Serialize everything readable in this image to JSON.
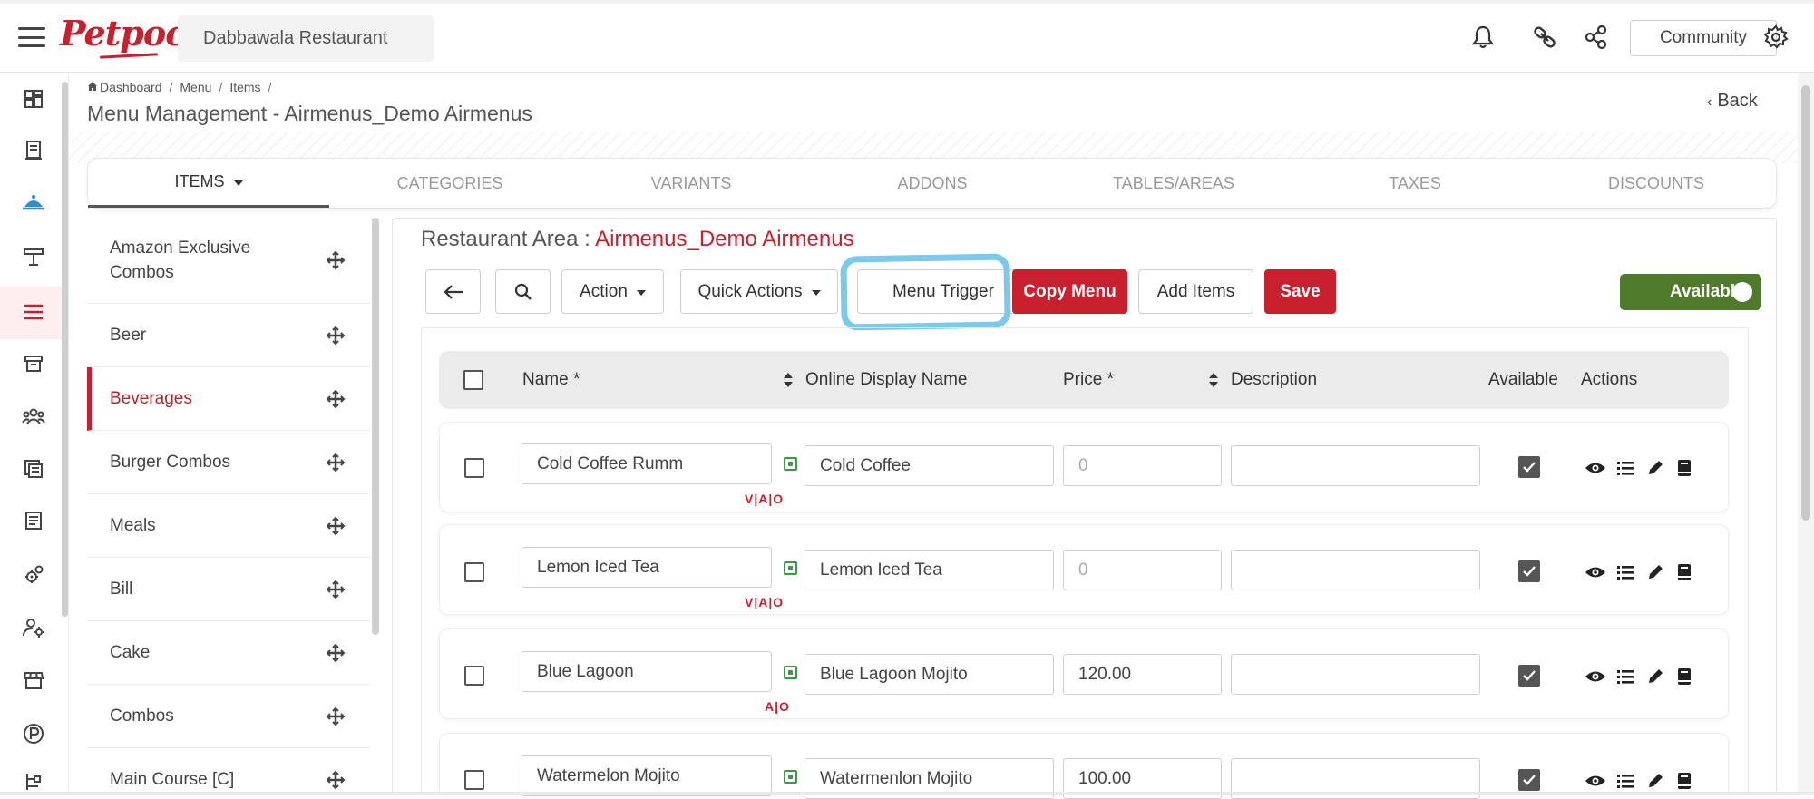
{
  "header": {
    "logo_text": "Petpooja",
    "restaurant_name": "Dabbawala Restaurant",
    "community_label": "Community",
    "icons": [
      "menu-icon",
      "bell-icon",
      "link-icon",
      "share-icon",
      "gear-icon"
    ]
  },
  "sidebar": {
    "icons": [
      "dashboard-icon",
      "receipt-icon",
      "waiter-service-icon",
      "table-icon",
      "menu-list-icon",
      "archive-icon",
      "users-icon",
      "calculator-icon",
      "document-icon",
      "settings-cog-icon",
      "user-settings-icon",
      "store-icon",
      "parking-icon",
      "hierarchy-icon"
    ],
    "active_index": 4
  },
  "breadcrumb": [
    "Dashboard",
    "Menu",
    "Items"
  ],
  "page_title": "Menu Management - Airmenus_Demo Airmenus",
  "back_label": "Back",
  "tabs": [
    {
      "label": "ITEMS",
      "active": true
    },
    {
      "label": "CATEGORIES",
      "active": false
    },
    {
      "label": "VARIANTS",
      "active": false
    },
    {
      "label": "ADDONS",
      "active": false
    },
    {
      "label": "TABLES/AREAS",
      "active": false
    },
    {
      "label": "TAXES",
      "active": false
    },
    {
      "label": "DISCOUNTS",
      "active": false
    }
  ],
  "categories": [
    {
      "label": "Amazon Exclusive Combos",
      "active": false
    },
    {
      "label": "Beer",
      "active": false
    },
    {
      "label": "Beverages",
      "active": true
    },
    {
      "label": "Burger Combos",
      "active": false
    },
    {
      "label": "Meals",
      "active": false
    },
    {
      "label": "Bill",
      "active": false
    },
    {
      "label": "Cake",
      "active": false
    },
    {
      "label": "Combos",
      "active": false
    },
    {
      "label": "Main Course [C]",
      "active": false
    }
  ],
  "area": {
    "prefix": "Restaurant Area : ",
    "name": "Airmenus_Demo Airmenus"
  },
  "toolbar": {
    "action_label": "Action",
    "quick_actions_label": "Quick Actions",
    "menu_trigger_label": "Menu Trigger",
    "copy_menu_label": "Copy Menu",
    "add_items_label": "Add Items",
    "save_label": "Save",
    "available_label": "Available"
  },
  "table": {
    "headers": {
      "name": "Name *",
      "online_display_name": "Online Display Name",
      "price": "Price *",
      "description": "Description",
      "available": "Available",
      "actions": "Actions"
    },
    "rows": [
      {
        "name": "Cold Coffee Rumm",
        "online_name": "Cold Coffee",
        "price": "0",
        "price_disabled": true,
        "description": "",
        "tags": "V|A|O",
        "available": true
      },
      {
        "name": "Lemon Iced Tea",
        "online_name": "Lemon Iced Tea",
        "price": "0",
        "price_disabled": true,
        "description": "",
        "tags": "V|A|O",
        "available": true
      },
      {
        "name": "Blue Lagoon",
        "online_name": "Blue Lagoon Mojito",
        "price": "120.00",
        "price_disabled": false,
        "description": "",
        "tags": "A|O",
        "available": true
      },
      {
        "name": "Watermelon Mojito",
        "online_name": "Watermenlon Mojito",
        "price": "100.00",
        "price_disabled": false,
        "description": "",
        "tags": "",
        "available": true
      }
    ]
  },
  "colors": {
    "brand_red": "#c8202f",
    "available_green": "#4e7a2a",
    "highlight_blue": "#7cc9ee",
    "veg_green": "#3a9a47"
  }
}
